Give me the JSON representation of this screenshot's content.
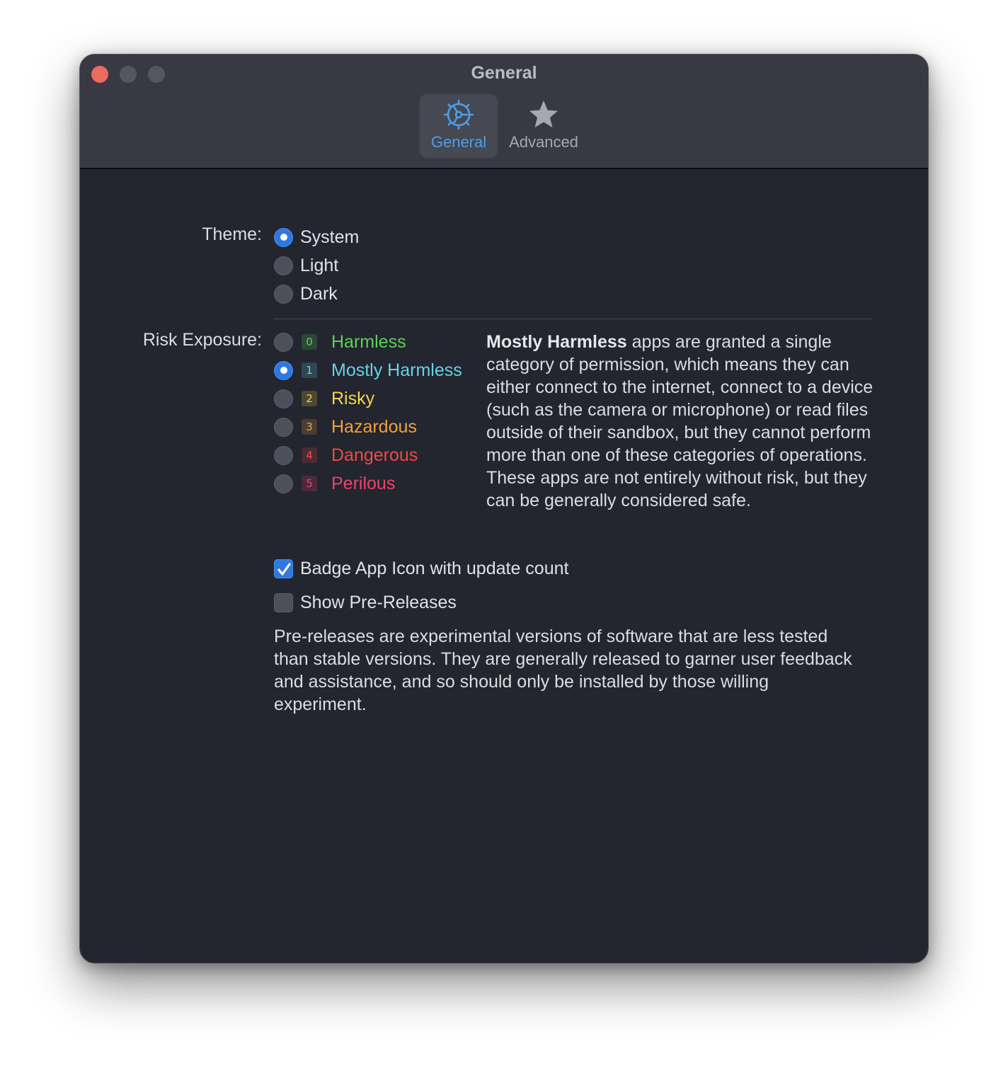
{
  "window": {
    "title": "General"
  },
  "toolbar": {
    "tabs": [
      {
        "label": "General",
        "icon": "gear-icon",
        "selected": true
      },
      {
        "label": "Advanced",
        "icon": "star-icon",
        "selected": false
      }
    ]
  },
  "theme": {
    "label": "Theme:",
    "options": [
      "System",
      "Light",
      "Dark"
    ],
    "selected": "System"
  },
  "risk": {
    "label": "Risk Exposure:",
    "options": [
      {
        "level": "0",
        "name": "Harmless",
        "color": "#5fcf5a"
      },
      {
        "level": "1",
        "name": "Mostly Harmless",
        "color": "#65d4e6"
      },
      {
        "level": "2",
        "name": "Risky",
        "color": "#f2d54a"
      },
      {
        "level": "3",
        "name": "Hazardous",
        "color": "#f1a13c"
      },
      {
        "level": "4",
        "name": "Dangerous",
        "color": "#ee4a44"
      },
      {
        "level": "5",
        "name": "Perilous",
        "color": "#e9456a"
      }
    ],
    "selected": "Mostly Harmless",
    "description_title": "Mostly Harmless",
    "description": " apps are granted a single category of permission, which means they can either connect to the internet, connect to a device (such as the camera or microphone) or read files outside of their sandbox, but they cannot perform more than one of these categories of operations. These apps are not entirely without risk, but they can be generally considered safe."
  },
  "options": {
    "badge_label": "Badge App Icon with update count",
    "badge_checked": true,
    "prerelease_label": "Show Pre-Releases",
    "prerelease_checked": false,
    "prerelease_description": "Pre-releases are experimental versions of software that are less tested than stable versions. They are generally released to garner user feedback and assistance, and so should only be installed by those willing experiment."
  },
  "colors": {
    "accent": "#2f78e0",
    "window_bg": "#23252f",
    "titlebar_bg": "#383943"
  }
}
